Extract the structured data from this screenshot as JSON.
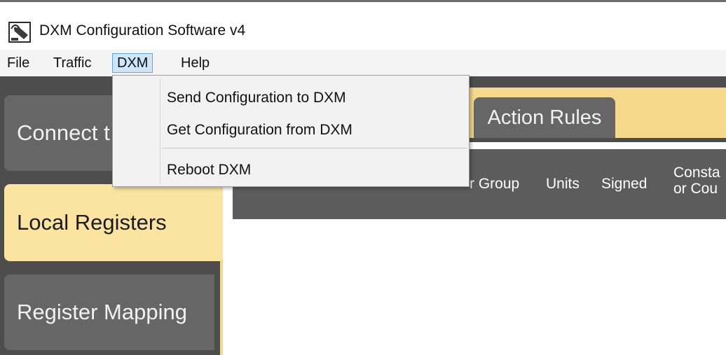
{
  "window": {
    "title": "DXM Configuration Software v4",
    "icon": "antenna-icon"
  },
  "menubar": {
    "items": [
      {
        "label": "File"
      },
      {
        "label": "Traffic"
      },
      {
        "label": "DXM",
        "active": true
      },
      {
        "label": "Help"
      }
    ]
  },
  "dropdown": {
    "items": [
      {
        "label": "Send Configuration to DXM"
      },
      {
        "label": "Get Configuration from DXM"
      },
      {
        "label": "Reboot DXM"
      }
    ]
  },
  "sidebar": {
    "tabs": [
      {
        "label": "Connect t"
      },
      {
        "label": "Local Registers",
        "active": true
      },
      {
        "label": "Register Mapping"
      }
    ]
  },
  "top_tabs": {
    "action_rules": "Action Rules"
  },
  "table": {
    "columns": [
      {
        "label": "r Group"
      },
      {
        "label": "Units"
      },
      {
        "label": "Signed"
      },
      {
        "label_line1": "Consta",
        "label_line2": "or Cou"
      }
    ]
  },
  "colors": {
    "sidebar_bg": "#4d4d4d",
    "tab_inactive": "#666666",
    "tab_active": "#fbe3a0",
    "accent_strip": "#f7d98c",
    "menu_highlight": "#cfe6f8"
  }
}
